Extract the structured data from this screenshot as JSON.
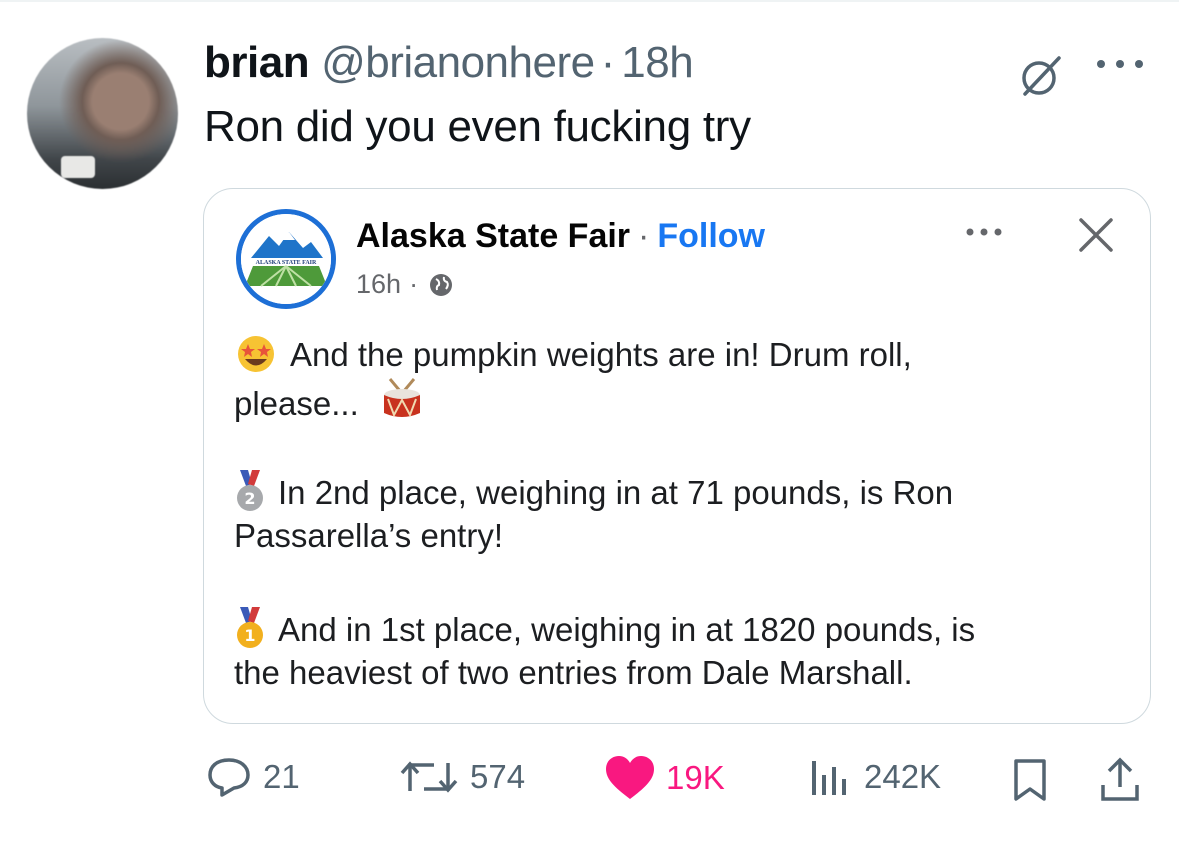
{
  "tweet": {
    "author_name": "brian",
    "author_handle": "@brianonhere",
    "separator": "·",
    "time": "18h",
    "text": "Ron did you even fucking try"
  },
  "embedded_post": {
    "page_name": "Alaska State Fair",
    "separator": "·",
    "follow_label": "Follow",
    "time": "16h",
    "meta_sep": "·",
    "logo_text": "ALASKA STATE FAIR",
    "lines": [
      "And the pumpkin weights are in! Drum roll,",
      "please...",
      "In 2nd place, weighing in at 71 pounds, is Ron",
      "Passarella’s entry!",
      "And in 1st place, weighing in at 1820 pounds, is",
      "the heaviest of two entries from Dale Marshall."
    ]
  },
  "actions": {
    "replies": "21",
    "reposts": "574",
    "likes": "19K",
    "views": "242K"
  },
  "colors": {
    "like": "#f91880",
    "follow": "#1877f2",
    "muted": "#536471"
  },
  "icons": [
    "grok-icon",
    "more-icon",
    "globe-icon",
    "close-icon",
    "star-struck-emoji",
    "drum-emoji",
    "second-place-medal-emoji",
    "first-place-medal-emoji",
    "reply-icon",
    "repost-icon",
    "heart-icon",
    "views-icon",
    "bookmark-icon",
    "share-icon"
  ]
}
